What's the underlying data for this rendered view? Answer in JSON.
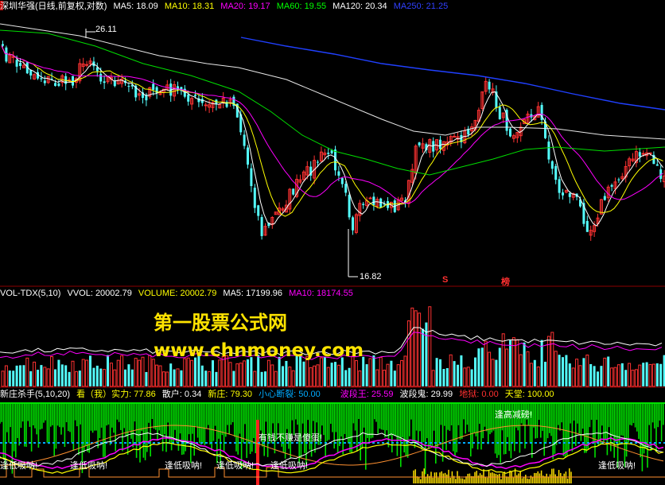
{
  "header_main": {
    "title": "深圳华强(日线,前复权,对数)",
    "items": [
      {
        "label": "MA5: 18.09",
        "color": "#ffffff"
      },
      {
        "label": "MA10: 18.31",
        "color": "#ffff00"
      },
      {
        "label": "MA20: 19.17",
        "color": "#ff00ff"
      },
      {
        "label": "MA60: 19.55",
        "color": "#00ff00"
      },
      {
        "label": "MA120: 20.34",
        "color": "#ffffff"
      },
      {
        "label": "MA250: 21.25",
        "color": "#3040ff"
      }
    ]
  },
  "header_vol": {
    "title": "VOL-TDX(5,10)",
    "items": [
      {
        "label": "VVOL: 20002.79",
        "color": "#ffffff"
      },
      {
        "label": "VOLUME: 20002.79",
        "color": "#ffff00"
      },
      {
        "label": "MA5: 17199.96",
        "color": "#ffffff"
      },
      {
        "label": "MA10: 18174.55",
        "color": "#ff00ff"
      }
    ]
  },
  "header_ind": {
    "title": "新庄杀手(5,10,20)",
    "items": [
      {
        "label": "看（我）实力: 77.86",
        "color": "#ffff00"
      },
      {
        "label": "散户: 0.34",
        "color": "#ffffff"
      },
      {
        "label": "新庄: 79.30",
        "color": "#ffff00"
      },
      {
        "label": "小心断裂: 50.00",
        "color": "#00aaff"
      },
      {
        "label": "波段王: 25.59",
        "color": "#ff00ff"
      },
      {
        "label": "波段鬼: 29.99",
        "color": "#ffffff"
      },
      {
        "label": "地狱: 0.00",
        "color": "#ff3030"
      },
      {
        "label": "天堂: 100.00",
        "color": "#ffff00"
      }
    ]
  },
  "watermark": {
    "line1": "第一股票公式网",
    "line2": "www.chnmoney.com"
  },
  "annotations": {
    "high": "26.11",
    "low": "16.82",
    "mark_s": "S",
    "mark_bang": "榜",
    "ind_note1": "逢高减磅!",
    "ind_note2": "有钱不赚是傻蛋!",
    "ind_note3": "逢低吸呐!",
    "ind_note4": "逢低吸呐!",
    "ind_note5": "逢低吸呐!",
    "ind_note6": "逢低吸呐!",
    "ind_note7": "逢低吸呐!",
    "ind_note8": "逢低吸呐!"
  },
  "colors": {
    "up": "#ff3232",
    "down": "#54ffff",
    "green_hist": "#00e000",
    "grid": "#8b0000"
  },
  "chart_data": [
    {
      "type": "candlestick",
      "title": "深圳华强(日线,前复权,对数)",
      "log_scale": true,
      "high_label": 26.11,
      "low_label": 16.82,
      "ma": {
        "MA5": 18.09,
        "MA10": 18.31,
        "MA20": 19.17,
        "MA60": 19.55,
        "MA120": 20.34,
        "MA250": 21.25
      }
    },
    {
      "type": "bar",
      "title": "VOL-TDX(5,10)",
      "last": {
        "VVOL": 20002.79,
        "VOLUME": 20002.79,
        "MA5": 17199.96,
        "MA10": 18174.55
      }
    },
    {
      "type": "line",
      "title": "新庄杀手(5,10,20)",
      "last": {
        "看（我）实力": 77.86,
        "散户": 0.34,
        "新庄": 79.3,
        "小心断裂": 50.0,
        "波段王": 25.59,
        "波段鬼": 29.99,
        "地狱": 0.0,
        "天堂": 100.0
      }
    }
  ]
}
